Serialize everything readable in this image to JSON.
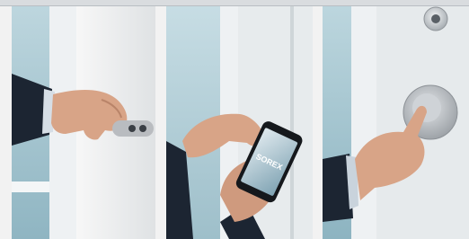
{
  "photos": [
    {
      "id": "keyfob",
      "description_visible_text": ""
    },
    {
      "id": "smartphone",
      "screen_brand_text": "SOREX"
    },
    {
      "id": "button",
      "description_visible_text": ""
    }
  ],
  "colors": {
    "glass": "#a9c9d3",
    "frame": "#e9ecee",
    "sleeve": "#1c2532",
    "skin": "#d8a487",
    "metal": "#b9bcc0"
  }
}
